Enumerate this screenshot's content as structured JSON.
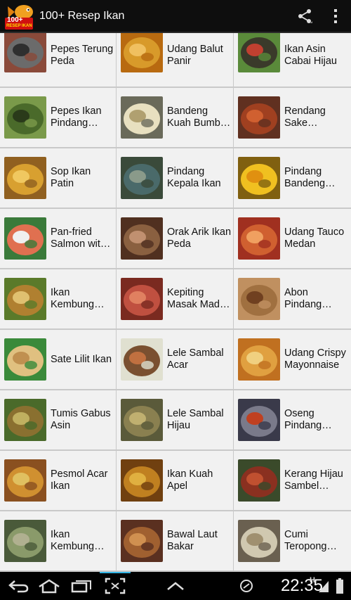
{
  "app": {
    "title": "100+ Resep Ikan",
    "icon_text_top": "100+",
    "icon_text_bottom": "RESEP IKAN"
  },
  "recipes": [
    {
      "name": "Pepes Terung Peda",
      "colors": [
        "#6b6b6b",
        "#2f2f2f",
        "#8a4a3a"
      ]
    },
    {
      "name": "Udang Balut Panir",
      "colors": [
        "#d89a2a",
        "#f0c060",
        "#b86a10"
      ]
    },
    {
      "name": "Ikan Asin Cabai Hijau",
      "colors": [
        "#3a3a2a",
        "#c04030",
        "#5a8a3a"
      ]
    },
    {
      "name": "Pepes Ikan Pindang…",
      "colors": [
        "#4a6a2a",
        "#2a3a1a",
        "#7a9a4a"
      ]
    },
    {
      "name": "Bandeng Kuah Bumb…",
      "colors": [
        "#e8e0c0",
        "#b0a070",
        "#6a6a5a"
      ]
    },
    {
      "name": "Rendang Sake…",
      "colors": [
        "#a04020",
        "#d06030",
        "#603020"
      ]
    },
    {
      "name": "Sop Ikan Patin",
      "colors": [
        "#d8a030",
        "#f0c860",
        "#906020"
      ]
    },
    {
      "name": "Pindang Kepala Ikan",
      "colors": [
        "#4a6a6a",
        "#8a9a8a",
        "#3a4a3a"
      ]
    },
    {
      "name": "Pindang Bandeng…",
      "colors": [
        "#f0c020",
        "#e09010",
        "#806010"
      ]
    },
    {
      "name": "Pan-fried Salmon wit…",
      "colors": [
        "#e07050",
        "#f0f0f0",
        "#3a7a3a"
      ]
    },
    {
      "name": "Orak Arik Ikan Peda",
      "colors": [
        "#8a6040",
        "#c09070",
        "#503020"
      ]
    },
    {
      "name": "Udang Tauco Medan",
      "colors": [
        "#d06030",
        "#f0a060",
        "#a03020"
      ]
    },
    {
      "name": "Ikan Kembung…",
      "colors": [
        "#b08030",
        "#e0c070",
        "#5a7a2a"
      ]
    },
    {
      "name": "Kepiting Masak Mad…",
      "colors": [
        "#c05040",
        "#e08060",
        "#7a2a20"
      ]
    },
    {
      "name": "Abon Pindang…",
      "colors": [
        "#a07040",
        "#704020",
        "#c09060"
      ]
    },
    {
      "name": "Sate Lilit Ikan",
      "colors": [
        "#e0c080",
        "#c09050",
        "#3a8a3a"
      ]
    },
    {
      "name": "Lele Sambal Acar",
      "colors": [
        "#7a5030",
        "#c07040",
        "#e0e0d0"
      ]
    },
    {
      "name": "Udang Crispy Mayonnaise",
      "colors": [
        "#e0a040",
        "#f0d080",
        "#c07020"
      ]
    },
    {
      "name": "Tumis Gabus Asin",
      "colors": [
        "#8a7030",
        "#c0b060",
        "#4a6a2a"
      ]
    },
    {
      "name": "Lele Sambal Hijau",
      "colors": [
        "#8a8050",
        "#c0b070",
        "#5a5a3a"
      ]
    },
    {
      "name": "Oseng Pindang…",
      "colors": [
        "#7a7a8a",
        "#c04020",
        "#3a3a4a"
      ]
    },
    {
      "name": "Pesmol Acar Ikan",
      "colors": [
        "#d09030",
        "#e0c060",
        "#8a5020"
      ]
    },
    {
      "name": "Ikan Kuah Apel",
      "colors": [
        "#c08020",
        "#e0b040",
        "#704010"
      ]
    },
    {
      "name": "Kerang Hijau Sambel…",
      "colors": [
        "#8a3020",
        "#c05030",
        "#3a4a2a"
      ]
    },
    {
      "name": "Ikan Kembung…",
      "colors": [
        "#8a9a6a",
        "#b0b090",
        "#4a5a3a"
      ]
    },
    {
      "name": "Bawal Laut Bakar",
      "colors": [
        "#a06030",
        "#d09050",
        "#5a3020"
      ]
    },
    {
      "name": "Cumi Teropong…",
      "colors": [
        "#d0c8b0",
        "#a09070",
        "#6a6050"
      ]
    }
  ],
  "statusbar": {
    "time": "22:35",
    "network": "H"
  },
  "icons": {
    "share": "share-icon",
    "overflow": "overflow-menu-icon",
    "back": "back-icon",
    "home": "home-icon",
    "recents": "recent-apps-icon",
    "screenshot": "screenshot-icon",
    "menu_up": "chevron-up-icon",
    "sync": "sync-icon",
    "signal": "signal-icon",
    "battery": "battery-icon"
  }
}
